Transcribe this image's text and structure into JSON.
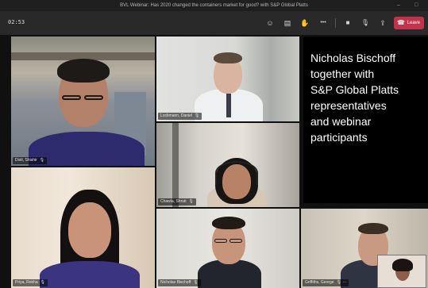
{
  "window": {
    "title": "BVL Webinar: Has 2020 changed the containers market for good? with S&P Global Platts",
    "minimize": "–",
    "maximize": "□"
  },
  "callbar": {
    "timer": "02:53",
    "controls": [
      {
        "name": "participants-icon",
        "glyph": "☺"
      },
      {
        "name": "chat-icon",
        "glyph": "▤"
      },
      {
        "name": "raise-hand-icon",
        "glyph": "✋"
      },
      {
        "name": "more-options-icon",
        "glyph": "•••"
      },
      {
        "name": "camera-icon",
        "glyph": "■"
      },
      {
        "name": "microphone-icon",
        "glyph": "🎙"
      },
      {
        "name": "share-screen-icon",
        "glyph": "⇪"
      }
    ],
    "leave_label": "Leave",
    "leave_color": "#c4314b"
  },
  "tiles": [
    {
      "id": "top-left",
      "name": "Dixit, Shishir",
      "mic": "🎙"
    },
    {
      "id": "top-center",
      "name": "Lockmann, Daniel",
      "mic": "🎙"
    },
    {
      "id": "middle-center",
      "name": "Chawla, Shruti",
      "mic": "🎙"
    },
    {
      "id": "bottom-left",
      "name": "Priya, Rekha",
      "mic": "🎙"
    },
    {
      "id": "bottom-center",
      "name": "Nicholas Bischoff",
      "mic": "🎙"
    },
    {
      "id": "bottom-right",
      "name": "Griffiths, George",
      "mic": "🎙 ···"
    }
  ],
  "caption": {
    "lines": [
      "Nicholas Bischoff",
      "together with",
      "S&P Global Platts",
      "representatives",
      "and webinar",
      "participants"
    ]
  }
}
